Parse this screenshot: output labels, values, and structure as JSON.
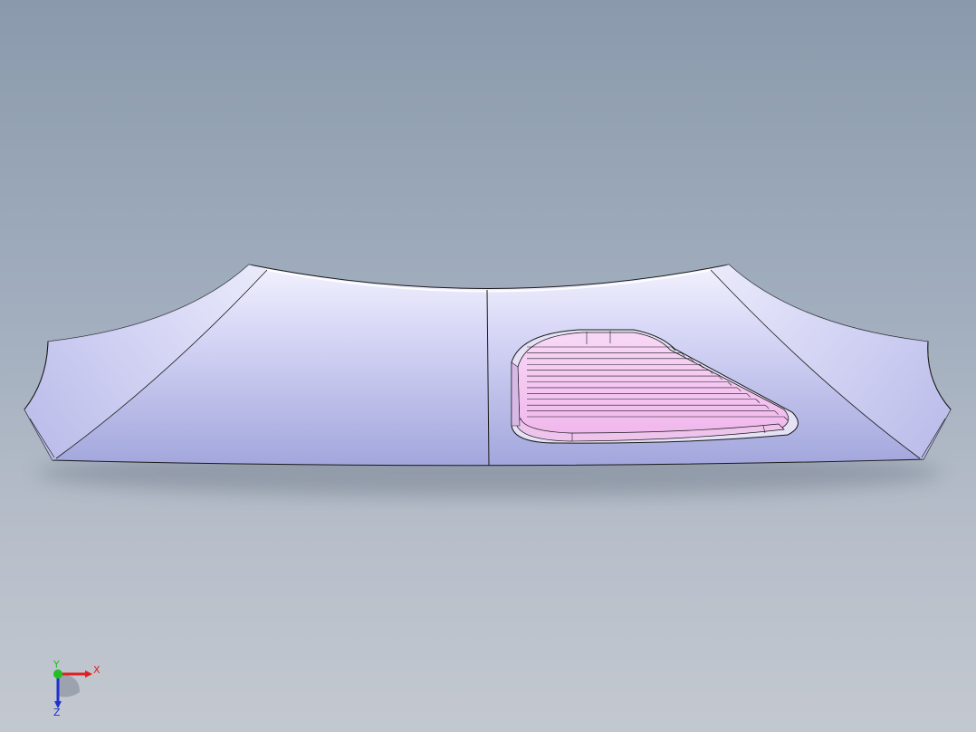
{
  "viewport": {
    "background_top": "#8a9aac",
    "background_bottom": "#c3c8d0"
  },
  "model": {
    "body_color": "#b9bdf0",
    "pocket_color": "#f2b8ee",
    "edge_color": "#1a1a1a",
    "pocket_step_count": 13
  },
  "triad": {
    "x_label": "X",
    "y_label": "Y",
    "z_label": "Z",
    "x_color": "#e02020",
    "y_color": "#20c020",
    "z_color": "#2030d0"
  }
}
